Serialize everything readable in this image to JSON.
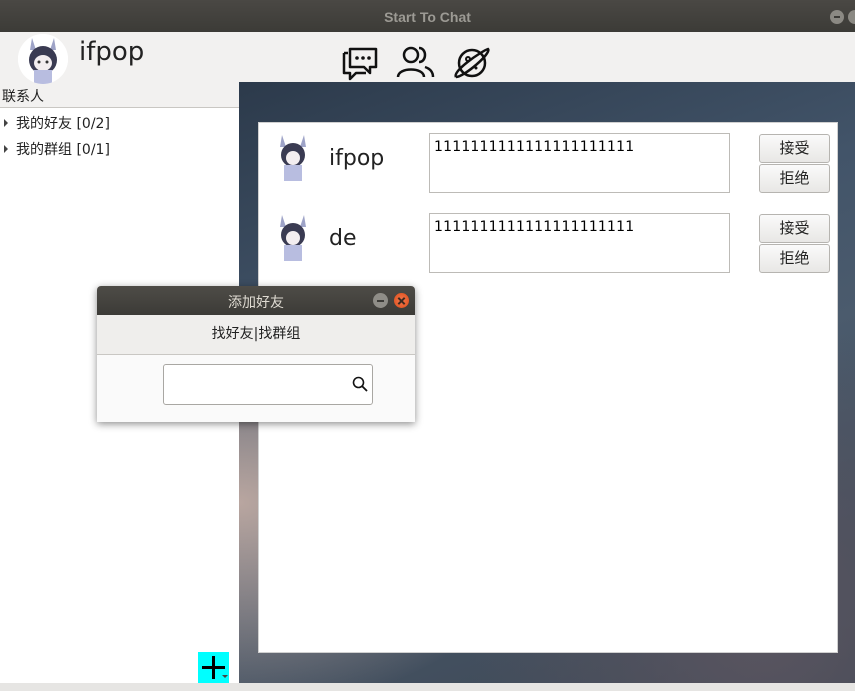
{
  "window": {
    "title": "Start To Chat"
  },
  "header": {
    "username": "ifpop",
    "nav_icons": [
      "chat-bubbles-icon",
      "contacts-icon",
      "planet-icon"
    ]
  },
  "sidebar": {
    "heading": "联系人",
    "groups": [
      {
        "label": "我的好友 [0/2]"
      },
      {
        "label": "我的群组 [0/1]"
      }
    ]
  },
  "requests": [
    {
      "name": "ifpop",
      "message": "1111111111111111111111",
      "accept_label": "接受",
      "reject_label": "拒绝"
    },
    {
      "name": "de",
      "message": "1111111111111111111111",
      "accept_label": "接受",
      "reject_label": "拒绝"
    }
  ],
  "dialog": {
    "title": "添加好友",
    "tabs_label": "找好友|找群组",
    "search_value": ""
  },
  "colors": {
    "add_button": "#00ffff",
    "close_button": "#df4a16"
  }
}
